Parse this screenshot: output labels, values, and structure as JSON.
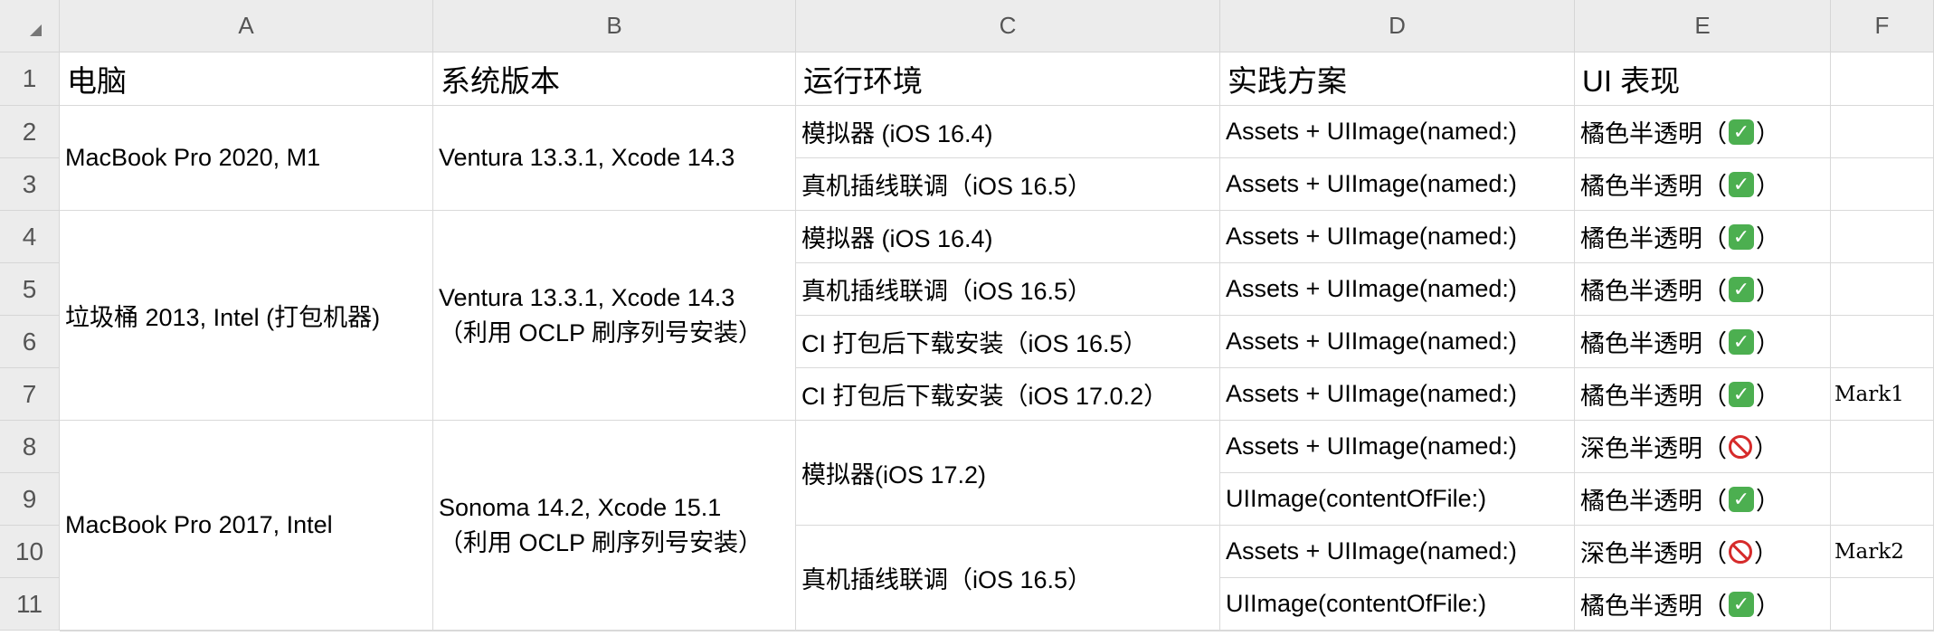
{
  "column_headers": [
    "A",
    "B",
    "C",
    "D",
    "E",
    "F"
  ],
  "row_numbers": [
    "1",
    "2",
    "3",
    "4",
    "5",
    "6",
    "7",
    "8",
    "9",
    "10",
    "11"
  ],
  "headers": {
    "computer": "电脑",
    "os_version": "系统版本",
    "environment": "运行环境",
    "approach": "实践方案",
    "ui_behavior": "UI 表现"
  },
  "groups": {
    "g1": {
      "computer": "MacBook Pro 2020, M1",
      "os_line1": "Ventura 13.3.1, Xcode 14.3"
    },
    "g2": {
      "computer": "垃圾桶 2013, Intel (打包机器)",
      "os_line1": "Ventura 13.3.1, Xcode 14.3",
      "os_line2": "（利用 OCLP 刷序列号安装）"
    },
    "g3": {
      "computer": "MacBook Pro 2017, Intel",
      "os_line1": "Sonoma 14.2, Xcode 15.1",
      "os_line2": "（利用 OCLP 刷序列号安装）"
    }
  },
  "environments": {
    "r2": "模拟器 (iOS 16.4)",
    "r3": "真机插线联调（iOS 16.5）",
    "r4": "模拟器 (iOS 16.4)",
    "r5": "真机插线联调（iOS 16.5）",
    "r6": "CI 打包后下载安装（iOS 16.5）",
    "r7": "CI 打包后下载安装（iOS 17.0.2）",
    "r8_9": "模拟器(iOS 17.2)",
    "r10_11": "真机插线联调（iOS 16.5）"
  },
  "approaches": {
    "r2": "Assets + UIImage(named:)",
    "r3": "Assets + UIImage(named:)",
    "r4": "Assets + UIImage(named:)",
    "r5": "Assets + UIImage(named:)",
    "r6": "Assets + UIImage(named:)",
    "r7": "Assets + UIImage(named:)",
    "r8": "Assets + UIImage(named:)",
    "r9": "UIImage(contentOfFile:)",
    "r10": "Assets + UIImage(named:)",
    "r11": "UIImage(contentOfFile:)"
  },
  "results": {
    "r2": {
      "text": "橘色半透明（",
      "close": "）",
      "icon": "check-icon"
    },
    "r3": {
      "text": "橘色半透明（",
      "close": "）",
      "icon": "check-icon"
    },
    "r4": {
      "text": "橘色半透明（",
      "close": "）",
      "icon": "check-icon"
    },
    "r5": {
      "text": "橘色半透明（",
      "close": "）",
      "icon": "check-icon"
    },
    "r6": {
      "text": "橘色半透明（",
      "close": "）",
      "icon": "check-icon"
    },
    "r7": {
      "text": "橘色半透明（",
      "close": "）",
      "icon": "check-icon"
    },
    "r8": {
      "text": "深色半透明（",
      "close": "）",
      "icon": "prohibited-icon"
    },
    "r9": {
      "text": "橘色半透明（",
      "close": "）",
      "icon": "check-icon"
    },
    "r10": {
      "text": "深色半透明（",
      "close": "）",
      "icon": "prohibited-icon"
    },
    "r11": {
      "text": "橘色半透明（",
      "close": "）",
      "icon": "check-icon"
    }
  },
  "marks": {
    "r7": "Mark1",
    "r10": "Mark2"
  },
  "colors": {
    "header_bg": "#ececec",
    "grid": "#d9d9d9",
    "check_green": "#4caf50",
    "prohibited_red": "#d62b2b"
  }
}
